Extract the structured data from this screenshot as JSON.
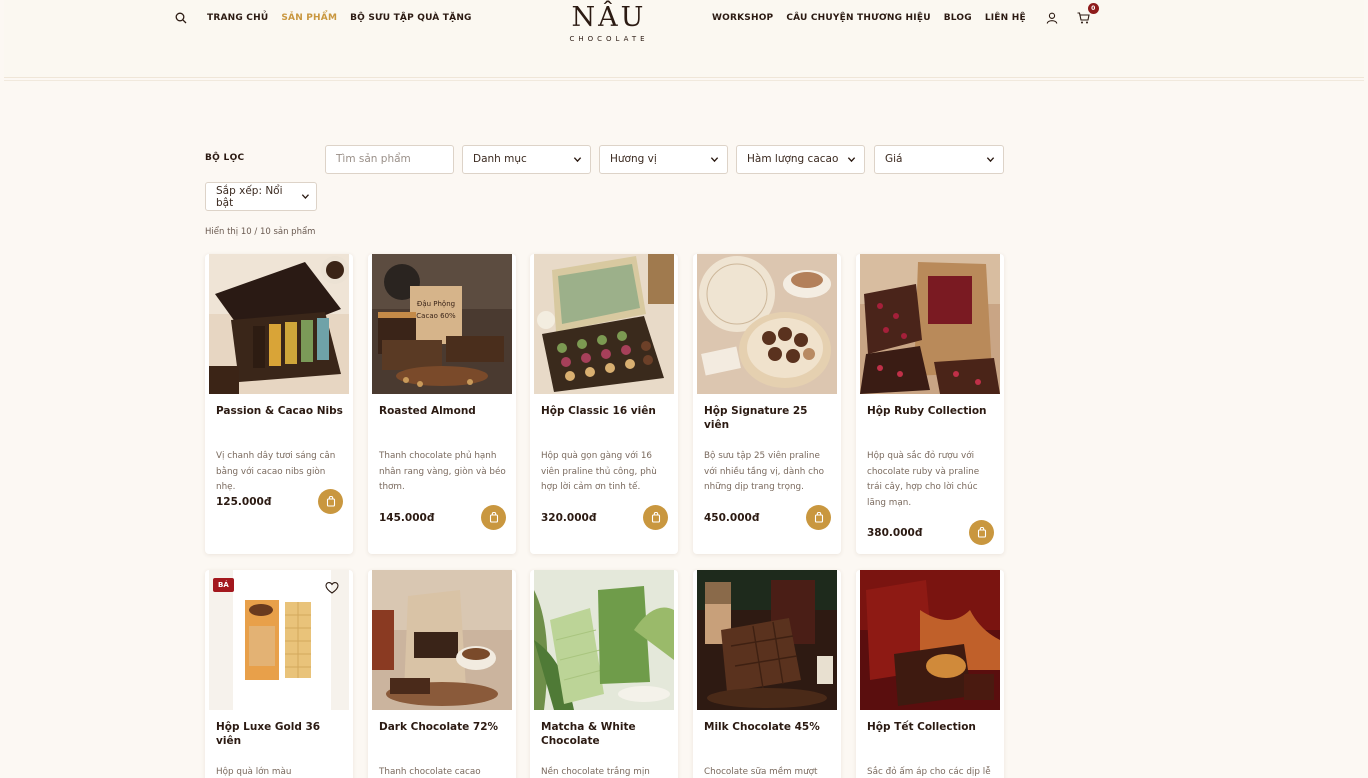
{
  "brand": {
    "name": "NÂU",
    "tagline": "CHOCOLATE"
  },
  "nav": {
    "left": [
      {
        "label": "TRANG CHỦ",
        "active": false
      },
      {
        "label": "SẢN PHẨM",
        "active": true
      },
      {
        "label": "BỘ SƯU TẬP QUÀ TẶNG",
        "active": false
      }
    ],
    "right": [
      {
        "label": "WORKSHOP"
      },
      {
        "label": "CÂU CHUYỆN THƯƠNG HIỆU"
      },
      {
        "label": "BLOG"
      },
      {
        "label": "LIÊN HỆ"
      }
    ],
    "cart_count": "0",
    "icons": [
      "search-icon",
      "user-icon",
      "cart-icon"
    ]
  },
  "filters": {
    "label": "BỘ LỌC",
    "search_placeholder": "Tìm sản phẩm",
    "category": "Danh mục",
    "flavor": "Hương vị",
    "cacao": "Hàm lượng cacao",
    "price": "Giá",
    "sort": "Sắp xếp: Nổi bật"
  },
  "results": {
    "text": "Hiển thị 10 / 10 sản phẩm"
  },
  "products": [
    {
      "name": "Passion & Cacao Nibs",
      "desc": "Vị chanh dây tươi sáng cân bằng với cacao nibs giòn nhẹ.",
      "price": "125.000đ"
    },
    {
      "name": "Roasted Almond",
      "desc": "Thanh chocolate phủ hạnh nhân rang vàng, giòn và béo thơm.",
      "price": "145.000đ"
    },
    {
      "name": "Hộp Classic 16 viên",
      "desc": "Hộp quà gọn gàng với 16 viên praline thủ công, phù hợp lời cảm ơn tinh tế.",
      "price": "320.000đ"
    },
    {
      "name": "Hộp Signature 25 viên",
      "desc": "Bộ sưu tập 25 viên praline với nhiều tầng vị, dành cho những dịp trang trọng.",
      "price": "450.000đ"
    },
    {
      "name": "Hộp Ruby Collection",
      "desc": "Hộp quà sắc đỏ rượu với chocolate ruby và praline trái cây, hợp cho lời chúc lãng mạn.",
      "price": "380.000đ"
    },
    {
      "name": "Hộp Luxe Gold 36 viên",
      "desc": "Hộp quà lớn màu champagne",
      "price": "",
      "badge": "BÁ"
    },
    {
      "name": "Dark Chocolate 72%",
      "desc": "Thanh chocolate cacao",
      "price": ""
    },
    {
      "name": "Matcha & White Chocolate",
      "desc": "Nền chocolate trắng mịn béo",
      "price": ""
    },
    {
      "name": "Milk Chocolate 45%",
      "desc": "Chocolate sữa mềm mượt",
      "price": ""
    },
    {
      "name": "Hộp Tết Collection",
      "desc": "Sắc đỏ ấm áp cho các dịp lễ",
      "price": ""
    }
  ],
  "colors": {
    "accent": "#c9973f",
    "badge": "#a3181e",
    "text": "#2b1a12",
    "background": "#fcf8f3"
  }
}
